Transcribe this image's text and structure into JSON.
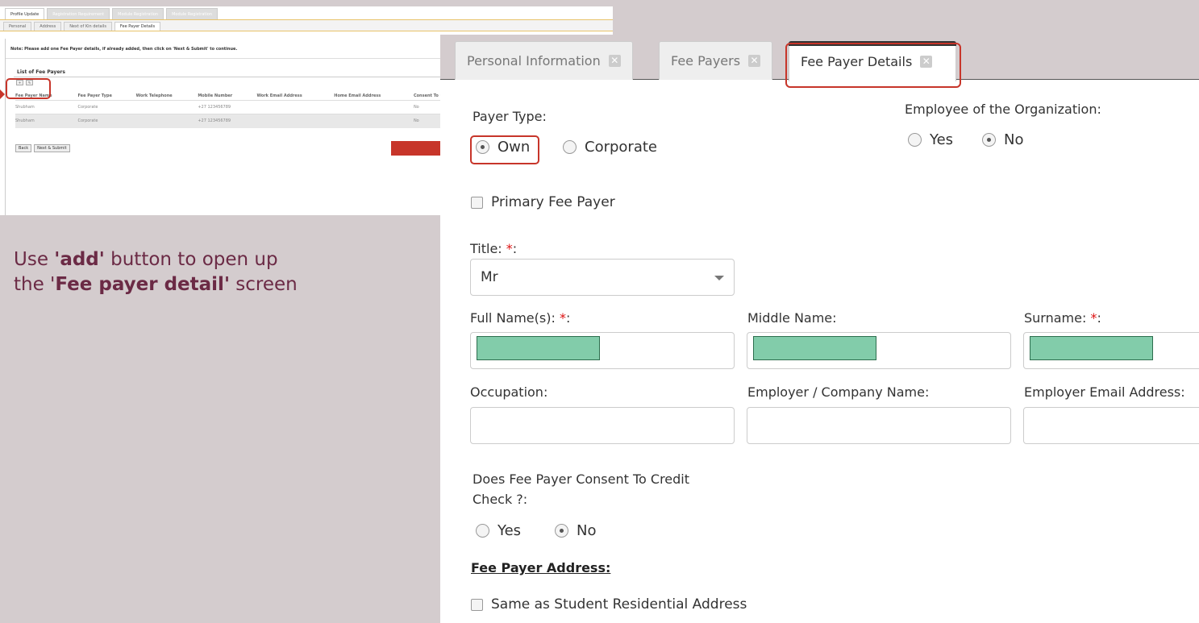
{
  "mini": {
    "top_tabs": [
      "Profile Update",
      "Registration Requirement",
      "Module Registration",
      "Module Registration"
    ],
    "sub_tabs": [
      "Personal",
      "Address",
      "Next of Kin details",
      "Fee Payer Details"
    ],
    "note": "Note: Please add one Fee Payer details, if already added, then click on 'Next & Submit' to continue.",
    "list_title": "List of Fee Payers",
    "columns": [
      "Fee Payer Name",
      "Fee Payer Type",
      "Work Telephone",
      "Mobile Number",
      "Work Email Address",
      "Home Email Address",
      "Consent To Cr"
    ],
    "rows": [
      [
        "Shubham",
        "Corporate",
        "",
        "+27 123456789",
        "",
        "",
        "No"
      ],
      [
        "Shubham",
        "Corporate",
        "",
        "+27 123456789",
        "",
        "",
        "No"
      ]
    ],
    "back_label": "Back",
    "next_label": "Next & Submit"
  },
  "caption": {
    "line1_pre": "Use ",
    "line1_bold": "'add'",
    "line1_post": " button to open up",
    "line2_pre": "the '",
    "line2_bold": "Fee payer detail'",
    "line2_post": " screen"
  },
  "tabs": [
    "Personal Information",
    "Fee Payers",
    "Fee Payer Details"
  ],
  "form": {
    "payer_type_label": "Payer Type:",
    "payer_type_options": [
      "Own",
      "Corporate"
    ],
    "employee_label": "Employee of the Organization:",
    "yes": "Yes",
    "no": "No",
    "primary_label": "Primary Fee Payer",
    "title_label": "Title: ",
    "title_value": "Mr",
    "full_name_label": "Full Name(s): ",
    "middle_name_label": "Middle Name:",
    "surname_label": "Surname: ",
    "occupation_label": "Occupation:",
    "employer_label": "Employer / Company Name:",
    "employer_email_label": "Employer Email Address:",
    "consent_label_1": "Does Fee Payer Consent To Credit",
    "consent_label_2": "Check ?:",
    "address_heading": "Fee Payer Address:",
    "same_address_label": "Same as Student Residential Address",
    "required_mark": "*",
    "colon": ":"
  },
  "colors": {
    "highlight": "#c7352a",
    "caption": "#6b2a45",
    "masked": "#82ccaa"
  }
}
